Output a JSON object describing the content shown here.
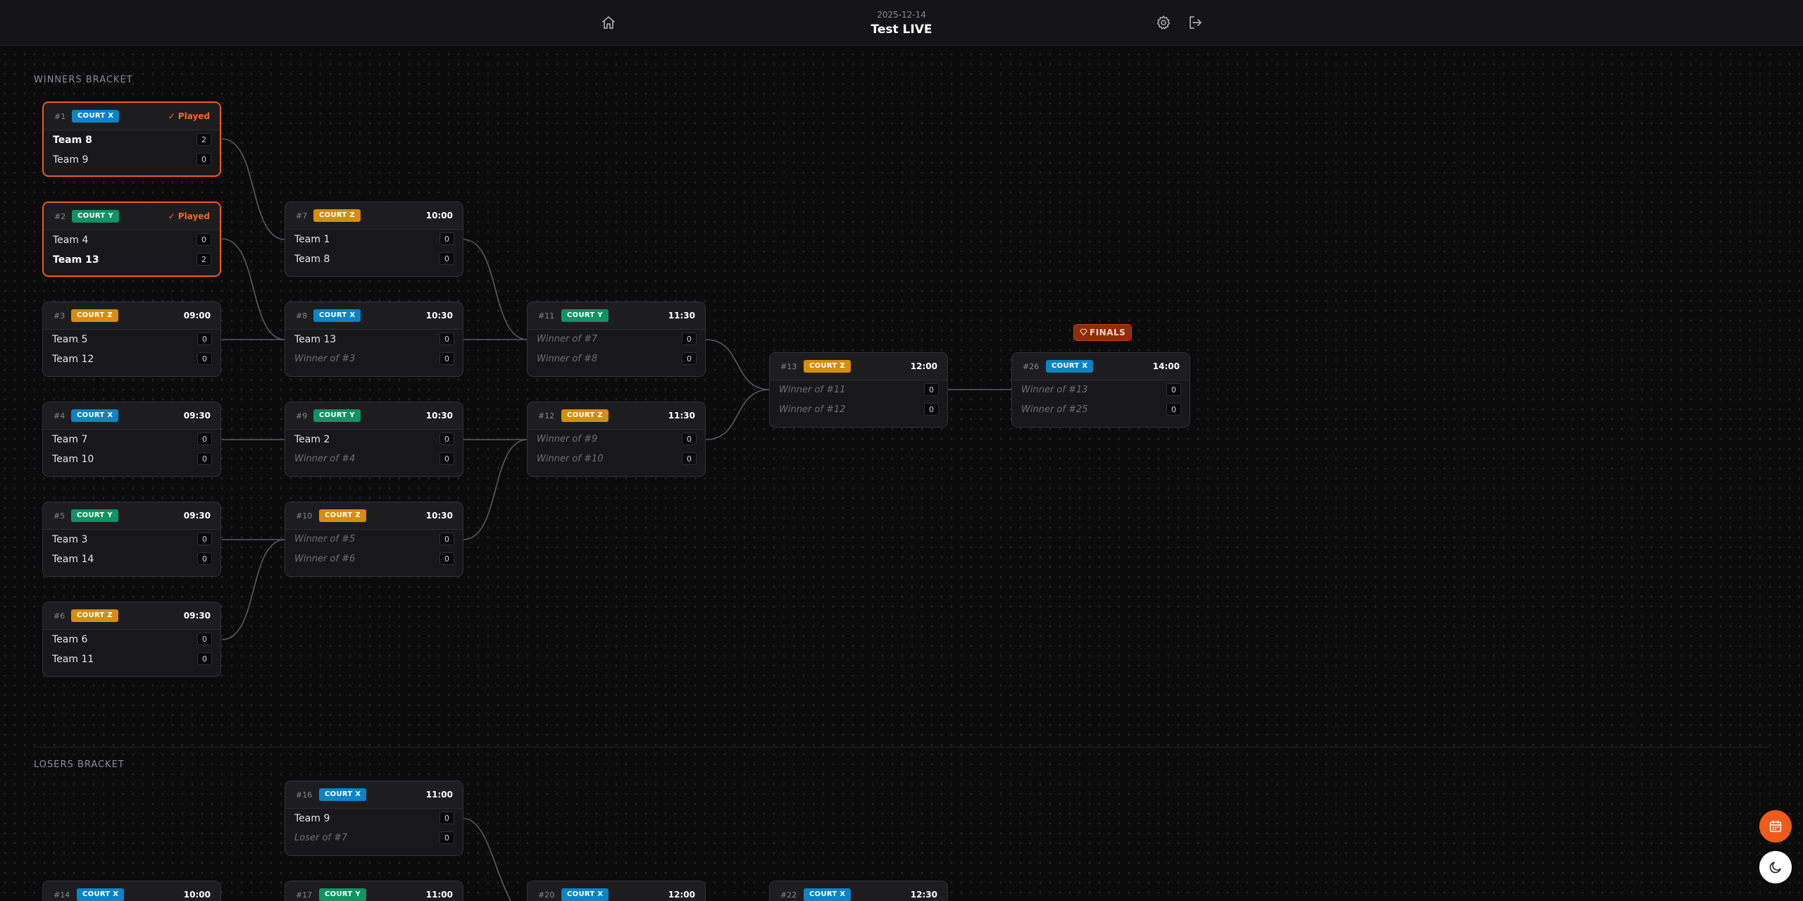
{
  "header": {
    "date": "2025-12-14",
    "title": "Test LIVE",
    "icons": [
      "home-icon",
      "gear-icon",
      "logout-icon"
    ]
  },
  "sections": {
    "winners": "WINNERS BRACKET",
    "losers": "LOSERS BRACKET"
  },
  "finals_label": "FINALS",
  "colors": {
    "accent": "#f05a1a",
    "court_x": "#0b84c6",
    "court_y": "#109364",
    "court_z": "#d88c0a"
  },
  "matches": {
    "m1": {
      "num": "#1",
      "court": "COURT X",
      "status": "✓ Played",
      "t1": "Team 8",
      "s1": "2",
      "t2": "Team 9",
      "s2": "0"
    },
    "m2": {
      "num": "#2",
      "court": "COURT Y",
      "status": "✓ Played",
      "t1": "Team 4",
      "s1": "0",
      "t2": "Team 13",
      "s2": "2"
    },
    "m3": {
      "num": "#3",
      "court": "COURT Z",
      "time": "09:00",
      "t1": "Team 5",
      "s1": "0",
      "t2": "Team 12",
      "s2": "0"
    },
    "m4": {
      "num": "#4",
      "court": "COURT X",
      "time": "09:30",
      "t1": "Team 7",
      "s1": "0",
      "t2": "Team 10",
      "s2": "0"
    },
    "m5": {
      "num": "#5",
      "court": "COURT Y",
      "time": "09:30",
      "t1": "Team 3",
      "s1": "0",
      "t2": "Team 14",
      "s2": "0"
    },
    "m6": {
      "num": "#6",
      "court": "COURT Z",
      "time": "09:30",
      "t1": "Team 6",
      "s1": "0",
      "t2": "Team 11",
      "s2": "0"
    },
    "m7": {
      "num": "#7",
      "court": "COURT Z",
      "time": "10:00",
      "t1": "Team 1",
      "s1": "0",
      "t2": "Team 8",
      "s2": "0"
    },
    "m8": {
      "num": "#8",
      "court": "COURT X",
      "time": "10:30",
      "t1": "Team 13",
      "s1": "0",
      "t2": "Winner of #3",
      "s2": "0"
    },
    "m9": {
      "num": "#9",
      "court": "COURT Y",
      "time": "10:30",
      "t1": "Team 2",
      "s1": "0",
      "t2": "Winner of #4",
      "s2": "0"
    },
    "m10": {
      "num": "#10",
      "court": "COURT Z",
      "time": "10:30",
      "t1": "Winner of #5",
      "s1": "0",
      "t2": "Winner of #6",
      "s2": "0"
    },
    "m11": {
      "num": "#11",
      "court": "COURT Y",
      "time": "11:30",
      "t1": "Winner of #7",
      "s1": "0",
      "t2": "Winner of #8",
      "s2": "0"
    },
    "m12": {
      "num": "#12",
      "court": "COURT Z",
      "time": "11:30",
      "t1": "Winner of #9",
      "s1": "0",
      "t2": "Winner of #10",
      "s2": "0"
    },
    "m13": {
      "num": "#13",
      "court": "COURT Z",
      "time": "12:00",
      "t1": "Winner of #11",
      "s1": "0",
      "t2": "Winner of #12",
      "s2": "0"
    },
    "m26": {
      "num": "#26",
      "court": "COURT X",
      "time": "14:00",
      "t1": "Winner of #13",
      "s1": "0",
      "t2": "Winner of #25",
      "s2": "0"
    },
    "m16": {
      "num": "#16",
      "court": "COURT X",
      "time": "11:00",
      "t1": "Team 9",
      "s1": "0",
      "t2": "Loser of #7",
      "s2": "0"
    },
    "m14": {
      "num": "#14",
      "court": "COURT X",
      "time": "10:00"
    },
    "m17": {
      "num": "#17",
      "court": "COURT Y",
      "time": "11:00"
    },
    "m20": {
      "num": "#20",
      "court": "COURT X",
      "time": "12:00"
    },
    "m22": {
      "num": "#22",
      "court": "COURT X",
      "time": "12:30"
    }
  }
}
